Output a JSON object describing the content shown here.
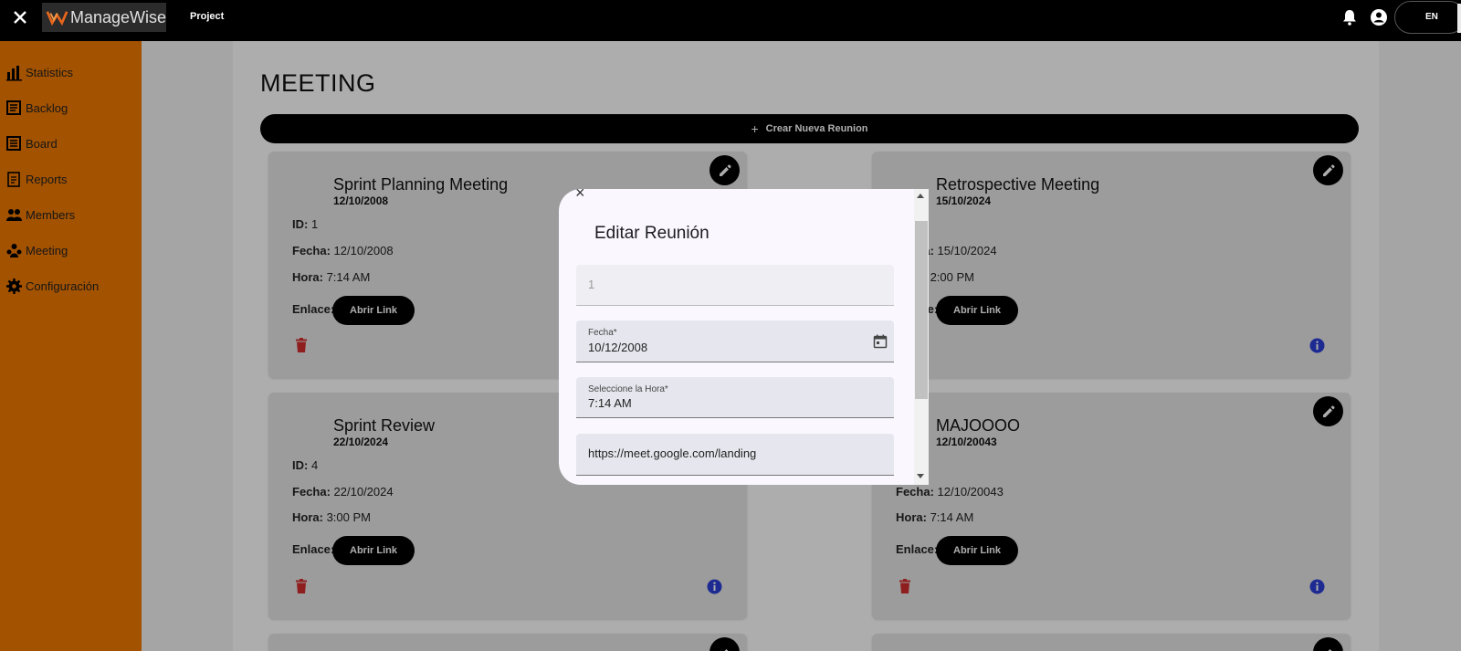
{
  "topbar": {
    "brand": "ManageWise",
    "project_link": "Project",
    "language": "EN"
  },
  "sidebar": {
    "items": [
      {
        "label": "Statistics",
        "icon": "chart-icon"
      },
      {
        "label": "Backlog",
        "icon": "list-icon"
      },
      {
        "label": "Board",
        "icon": "board-icon"
      },
      {
        "label": "Reports",
        "icon": "report-icon"
      },
      {
        "label": "Members",
        "icon": "members-icon"
      },
      {
        "label": "Meeting",
        "icon": "meeting-icon"
      },
      {
        "label": "Configuración",
        "icon": "gear-icon"
      }
    ]
  },
  "page": {
    "title": "MEETING",
    "create_button": "Crear Nueva Reunion"
  },
  "labels": {
    "id": "ID:",
    "fecha": "Fecha:",
    "hora": "Hora:",
    "enlace": "Enlace:",
    "open_link": "Abrir Link"
  },
  "meetings": [
    {
      "title": "Sprint Planning Meeting",
      "date": "12/10/2008",
      "id": "1",
      "fecha": "12/10/2008",
      "hora": "7:14 AM"
    },
    {
      "title": "Retrospective Meeting",
      "date": "15/10/2024",
      "fecha": "15/10/2024",
      "hora": "2:00 PM"
    },
    {
      "title": "Sprint Review",
      "date": "22/10/2024",
      "id": "4",
      "fecha": "22/10/2024",
      "hora": "3:00 PM"
    },
    {
      "title": "MAJOOOO",
      "date": "12/10/20043",
      "fecha": "12/10/20043",
      "hora": "7:14 AM"
    }
  ],
  "dialog": {
    "title": "Editar Reunión",
    "close": "×",
    "id_value": "1",
    "fecha_label": "Fecha*",
    "fecha_value": "10/12/2008",
    "hora_label": "Seleccione la Hora*",
    "hora_value": "7:14 AM",
    "link_value": "https://meet.google.com/landing"
  },
  "colors": {
    "sidebar": "#f07a00",
    "topbar": "#000000",
    "trash": "#d32f2f",
    "info": "#2c3fd8"
  }
}
